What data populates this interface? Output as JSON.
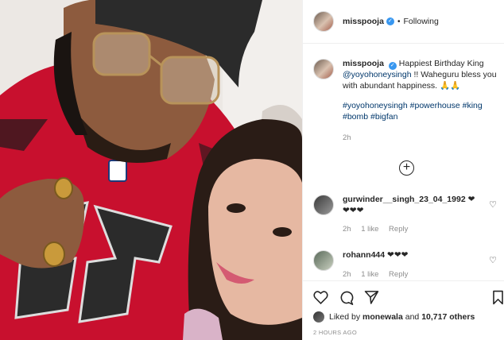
{
  "post": {
    "username": "misspooja",
    "follow_status": "Following",
    "separator": "•"
  },
  "caption": {
    "username": "misspooja",
    "text_before": "Happiest Birthday King",
    "mention": "@yoyohoneysingh",
    "text_after": "!! Waheguru bless you with abundant happiness. 🙏🙏",
    "hashtags": "#yoyohoneysingh #powerhouse #king #bomb #bigfan",
    "age": "2h"
  },
  "comments": [
    {
      "username": "gurwinder__singh_23_04_1992",
      "text": "❤❤❤❤",
      "age": "2h",
      "likes": "1 like",
      "reply": "Reply"
    },
    {
      "username": "rohann444",
      "text": "❤❤❤",
      "age": "2h",
      "likes": "1 like",
      "reply": "Reply"
    }
  ],
  "likes": {
    "liked_by_prefix": "Liked by",
    "liked_by_user": "monewala",
    "and": "and",
    "others": "10,717 others"
  },
  "timestamp": "2 HOURS AGO",
  "icons": [
    "verified-badge",
    "heart-icon",
    "comment-icon",
    "share-icon",
    "bookmark-icon",
    "load-more-icon"
  ],
  "colors": {
    "link": "#00376b",
    "verified": "#3897f0",
    "muted": "#8e8e8e",
    "jersey": "#c8102e"
  }
}
